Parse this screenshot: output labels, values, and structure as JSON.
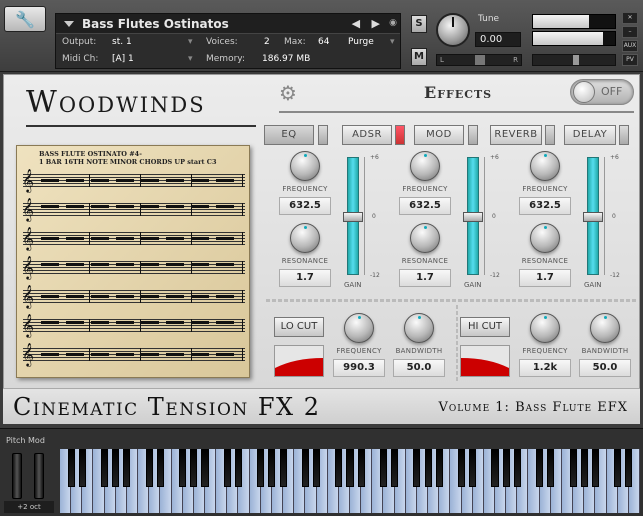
{
  "header": {
    "instrument_name": "Bass Flutes Ostinatos",
    "output_label": "Output:",
    "output_value": "st. 1",
    "voices_label": "Voices:",
    "voices_value": "2",
    "max_label": "Max:",
    "max_value": "64",
    "purge_label": "Purge",
    "midi_label": "Midi Ch:",
    "midi_value": "[A]  1",
    "memory_label": "Memory:",
    "memory_value": "186.97 MB",
    "s_label": "S",
    "m_label": "M",
    "tune_label": "Tune",
    "tune_value": "0.00",
    "pan_left": "L",
    "pan_right": "R",
    "aux_label": "AUX",
    "pv_label": "PV"
  },
  "panel": {
    "logo": "Woodwinds",
    "effects_title": "Effects",
    "effects_toggle": "OFF",
    "tabs": [
      {
        "label": "EQ",
        "active": true
      },
      {
        "label": "ADSR"
      },
      {
        "label": "MOD"
      },
      {
        "label": "REVERB"
      },
      {
        "label": "DELAY"
      }
    ],
    "score_title": "BASS FLUTE OSTINATO #4-\n1 BAR 16TH NOTE MINOR CHORDS UP start C3",
    "eq_bands": [
      {
        "frequency_label": "FREQUENCY",
        "frequency_value": "632.5",
        "resonance_label": "RESONANCE",
        "resonance_value": "1.7",
        "gain_label": "GAIN",
        "gain_max": "+6",
        "gain_mid": "0",
        "gain_min": "-12"
      },
      {
        "frequency_label": "FREQUENCY",
        "frequency_value": "632.5",
        "resonance_label": "RESONANCE",
        "resonance_value": "1.7",
        "gain_label": "GAIN",
        "gain_max": "+6",
        "gain_mid": "0",
        "gain_min": "-12"
      },
      {
        "frequency_label": "FREQUENCY",
        "frequency_value": "632.5",
        "resonance_label": "RESONANCE",
        "resonance_value": "1.7",
        "gain_label": "GAIN",
        "gain_max": "+6",
        "gain_mid": "0",
        "gain_min": "-12"
      }
    ],
    "lo_cut": {
      "button": "LO CUT",
      "frequency_label": "FREQUENCY",
      "frequency_value": "990.3",
      "bandwidth_label": "BANDWIDTH",
      "bandwidth_value": "50.0"
    },
    "hi_cut": {
      "button": "HI CUT",
      "frequency_label": "FREQUENCY",
      "frequency_value": "1.2k",
      "bandwidth_label": "BANDWIDTH",
      "bandwidth_value": "50.0"
    },
    "series_title": "Cinematic Tension FX 2",
    "volume_title": "Volume 1: Bass Flute EFX"
  },
  "keyboard": {
    "pitch_mod_label": "Pitch Mod",
    "octave_label": "+2 oct"
  },
  "colors": {
    "accent_cyan": "#33bbbb",
    "cut_red": "#cc0000",
    "key_white": "#b7c8e4",
    "led_on": "#dd4455"
  },
  "icons": [
    "wrench-icon",
    "camera-icon",
    "gear-icon",
    "chevron-down-icon",
    "arrow-left-icon",
    "arrow-right-icon"
  ]
}
